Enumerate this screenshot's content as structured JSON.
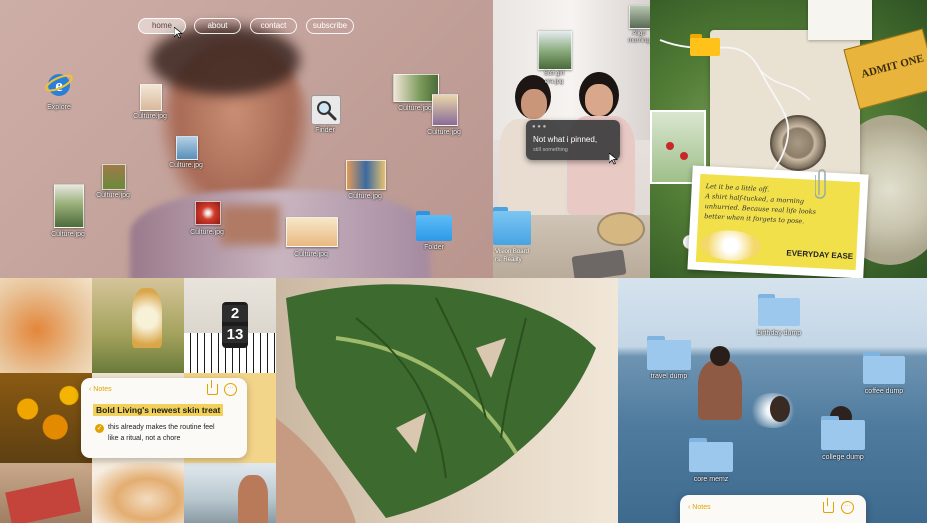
{
  "nav": {
    "home": "home",
    "about": "about",
    "contact": "contact",
    "subscribe": "subscribe"
  },
  "desktop1": {
    "explore": "Explore",
    "finder": "Finder",
    "folder": "Folder",
    "files": [
      "Culture.jpg",
      "Culture.jpg",
      "Culture.jpg",
      "Culture.jpg",
      "Culture.jpg",
      "Culture.jpg",
      "Culture.jpg",
      "Culture.jpg",
      "Culture.jpg"
    ]
  },
  "desktop2": {
    "thumb_label_1": "Soft girl",
    "thumb_label_2": "era.jpg",
    "top_right_label_1": "Align",
    "top_right_label_2": "morning",
    "popup_title": "Not what i pinned,",
    "popup_sub": "still something",
    "vision_1": "Vision Board",
    "vision_2": "rs. Reality"
  },
  "collage": {
    "note_card_1": "Let it be a little off.",
    "note_card_2": "A shirt half-tucked, a morning",
    "note_card_3": "unhurried. Because real life looks",
    "note_card_4": "better when it forgets to pose.",
    "note_card_brand": "EVERYDAY EASE",
    "ticket": "ADMIT ONE"
  },
  "clock": {
    "hour": "2",
    "minute": "13"
  },
  "notes1": {
    "back": "Notes",
    "title": "Bold Living's newest skin treat",
    "item_line1": "this already makes the routine feel",
    "item_line2": "like a ritual, not a chore"
  },
  "desktop3": {
    "folders": [
      "birthday dump",
      "travel dump",
      "coffee dump",
      "college dump",
      "core memz"
    ],
    "notes_back": "Notes"
  },
  "colors": {
    "notes_accent": "#e0a400",
    "folder_blue": "#8fc0ea",
    "mac_folder": "#3aa7f3"
  }
}
